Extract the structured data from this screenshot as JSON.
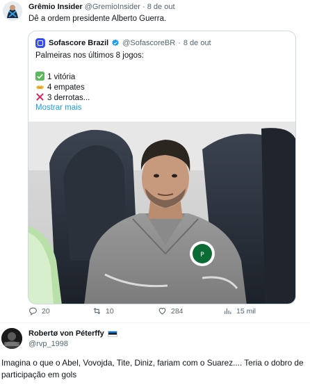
{
  "post": {
    "author_name": "Grêmio Insider",
    "author_handle": "@GremioInsider",
    "separator": "·",
    "date": "8 de out",
    "text": "Dê a ordem presidente Alberto Guerra.",
    "quote": {
      "author_name": "Sofascore Brazil",
      "author_handle": "@SofascoreBR",
      "separator": "·",
      "date": "8 de out",
      "line1": "Palmeiras nos últimos 8 jogos:",
      "stat1": "1 vitória",
      "stat2": "4 empates",
      "stat3": "3 derrotas...",
      "show_more": "Mostrar mais"
    },
    "actions": {
      "replies": "20",
      "reposts": "10",
      "likes": "284",
      "views": "15 mil"
    }
  },
  "reply": {
    "author_name": "Robertø von Péterffy",
    "author_handle": "@rvp_1998",
    "text": "Imagina o que o Abel, Vovojda, Tite, Diniz, fariam com o Suarez.... Teria o dobro de participação em gols"
  },
  "colors": {
    "accent": "#1d9bf0",
    "muted": "#536471",
    "border": "#cfd9de",
    "sofascore": "#374df5"
  }
}
